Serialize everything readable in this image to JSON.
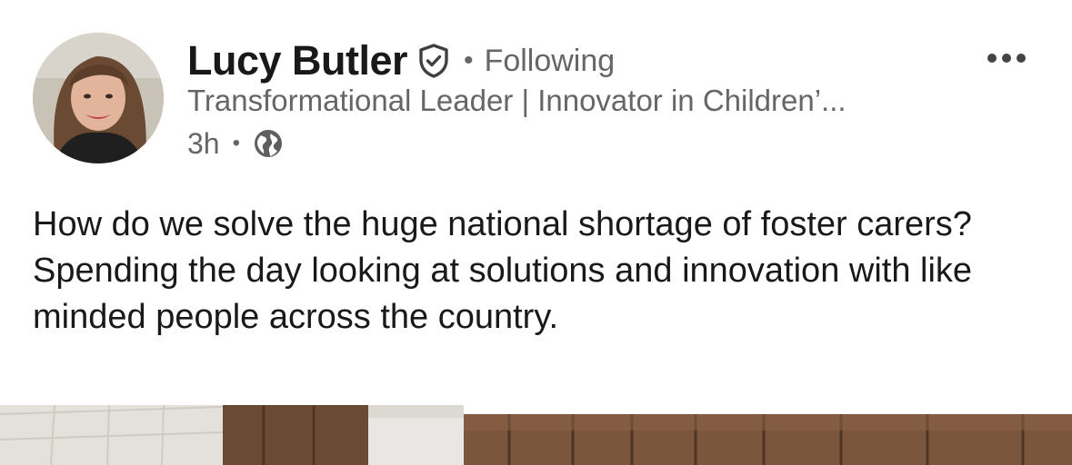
{
  "post": {
    "author": {
      "name": "Lucy Butler",
      "follow_status": "Following",
      "headline": "Transformational Leader | Innovator in Children’...",
      "time_ago": "3h",
      "separator": "•",
      "verified_icon": "verified-shield-icon",
      "visibility_icon": "globe-icon"
    },
    "body": {
      "lines": [
        "How do we solve the huge national shortage of foster carers?",
        "Spending the day looking at solutions and innovation with like minded people across the country."
      ]
    },
    "more_options_icon": "more-horizontal-icon"
  },
  "colors": {
    "text_primary": "#191919",
    "text_secondary": "#666666",
    "background": "#ffffff"
  }
}
